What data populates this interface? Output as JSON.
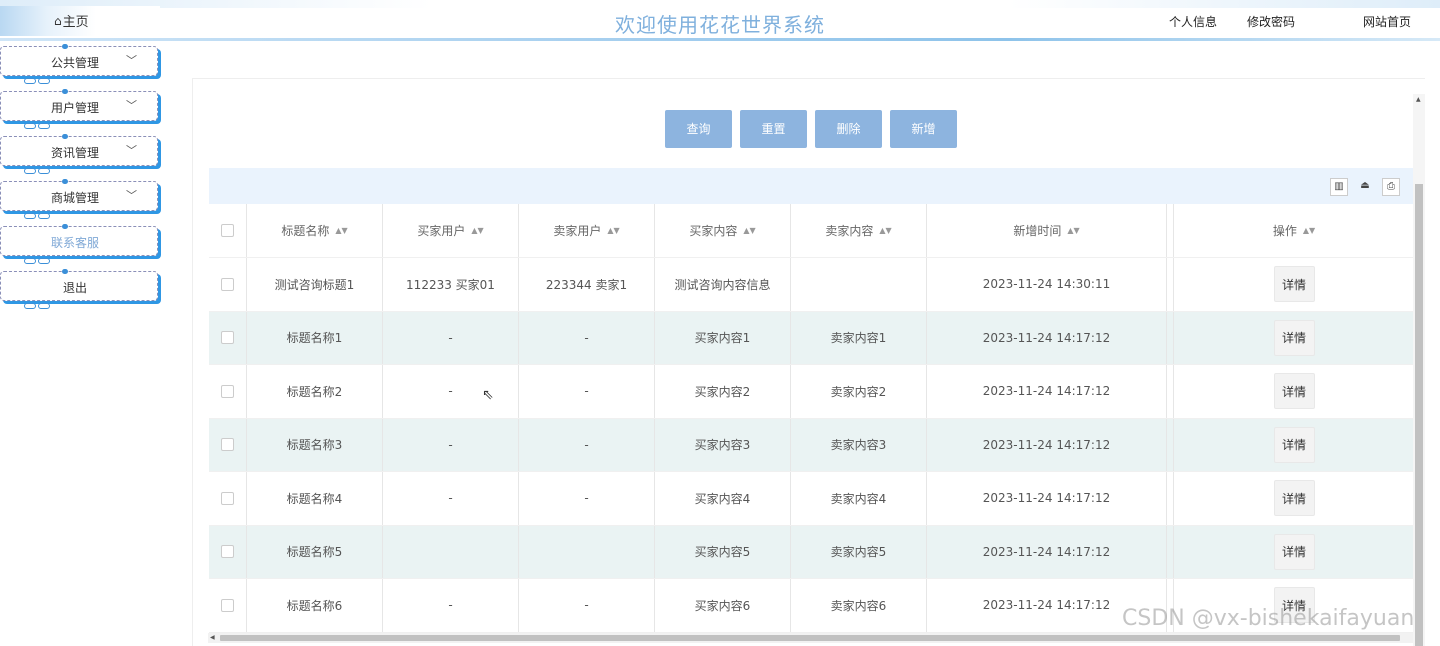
{
  "header": {
    "home_label": "主页",
    "title": "欢迎使用花花世界系统",
    "links": [
      "个人信息",
      "修改密码",
      "网站首页"
    ]
  },
  "sidebar": {
    "items": [
      {
        "label": "公共管理",
        "has_chevron": true
      },
      {
        "label": "用户管理",
        "has_chevron": true
      },
      {
        "label": "资讯管理",
        "has_chevron": true
      },
      {
        "label": "商城管理",
        "has_chevron": true
      },
      {
        "label": "联系客服",
        "has_chevron": false,
        "active": true
      },
      {
        "label": "退出",
        "has_chevron": false
      }
    ]
  },
  "toolbar": {
    "query": "查询",
    "reset": "重置",
    "delete": "删除",
    "add": "新增"
  },
  "table": {
    "columns": [
      "标题名称",
      "买家用户",
      "卖家用户",
      "买家内容",
      "卖家内容",
      "新增时间",
      "操作"
    ],
    "rows": [
      {
        "title": "测试咨询标题1",
        "buyer": "112233 买家01",
        "seller": "223344 卖家1",
        "buyer_content": "测试咨询内容信息",
        "seller_content": "",
        "time": "2023-11-24 14:30:11",
        "action": "详情"
      },
      {
        "title": "标题名称1",
        "buyer": "-",
        "seller": "-",
        "buyer_content": "买家内容1",
        "seller_content": "卖家内容1",
        "time": "2023-11-24 14:17:12",
        "action": "详情"
      },
      {
        "title": "标题名称2",
        "buyer": "-",
        "seller": "-",
        "buyer_content": "买家内容2",
        "seller_content": "卖家内容2",
        "time": "2023-11-24 14:17:12",
        "action": "详情"
      },
      {
        "title": "标题名称3",
        "buyer": "-",
        "seller": "-",
        "buyer_content": "买家内容3",
        "seller_content": "卖家内容3",
        "time": "2023-11-24 14:17:12",
        "action": "详情"
      },
      {
        "title": "标题名称4",
        "buyer": "-",
        "seller": "-",
        "buyer_content": "买家内容4",
        "seller_content": "卖家内容4",
        "time": "2023-11-24 14:17:12",
        "action": "详情"
      },
      {
        "title": "标题名称5",
        "buyer": "",
        "seller": "",
        "buyer_content": "买家内容5",
        "seller_content": "卖家内容5",
        "time": "2023-11-24 14:17:12",
        "action": "详情"
      },
      {
        "title": "标题名称6",
        "buyer": "-",
        "seller": "-",
        "buyer_content": "买家内容6",
        "seller_content": "卖家内容6",
        "time": "2023-11-24 14:17:12",
        "action": "详情"
      }
    ]
  },
  "watermark": "CSDN @vx-bishekaifayuan",
  "colors": {
    "accent": "#8db4df",
    "title": "#7fb0dd",
    "sidebar_shadow": "#2f97e4",
    "row_alt": "#eaf3f3",
    "toolbar_bg": "#eaf3fd"
  }
}
